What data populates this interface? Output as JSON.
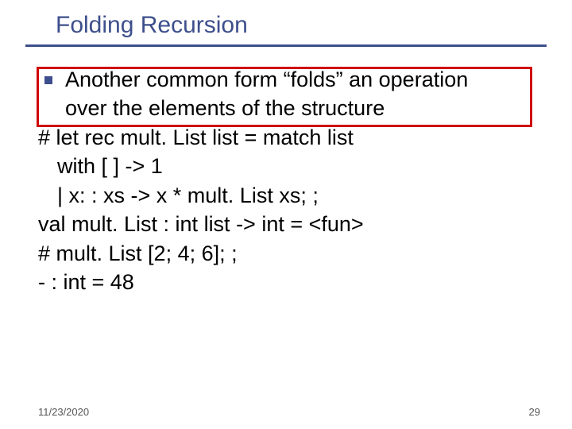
{
  "title": "Folding Recursion",
  "bullet": {
    "text1": "Another common form “folds” an operation",
    "text2": "over the elements of the structure"
  },
  "code": {
    "l1": "# let rec mult. List list = match list",
    "l2": "with [ ] -> 1",
    "l3": "| x: : xs -> x * mult. List xs; ;",
    "l4": "val mult. List : int list -> int = <fun>",
    "l5": "# mult. List [2; 4; 6]; ;",
    "l6": "- : int = 48"
  },
  "footer": {
    "date": "11/23/2020",
    "page": "29"
  }
}
